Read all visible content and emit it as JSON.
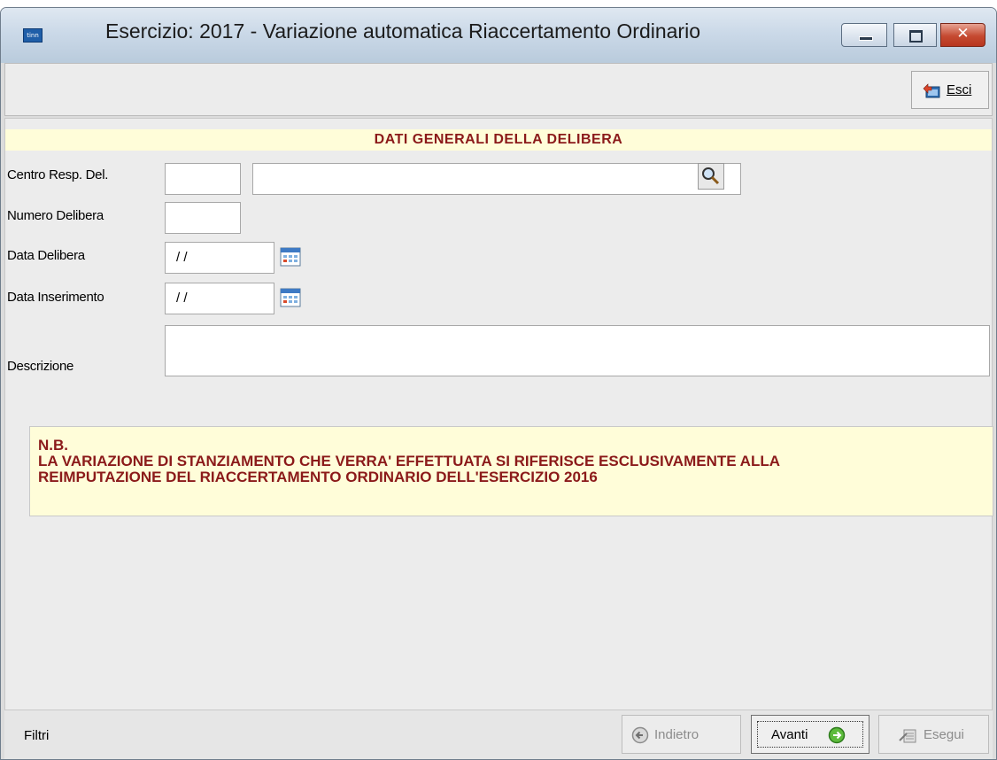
{
  "window": {
    "title": "Esercizio: 2017 - Variazione automatica Riaccertamento Ordinario",
    "app_icon_text": "tinn"
  },
  "toolbar": {
    "esci_label": "Esci"
  },
  "form": {
    "header": "DATI GENERALI DELLA DELIBERA",
    "centro_label": "Centro Resp. Del.",
    "centro_code_value": "",
    "centro_desc_value": "",
    "numero_label": "Numero Delibera",
    "numero_value": "",
    "data_delibera_label": "Data Delibera",
    "data_delibera_value": "/ /",
    "data_inserimento_label": "Data Inserimento",
    "data_inserimento_value": "/ /",
    "descrizione_label": "Descrizione",
    "descrizione_value": ""
  },
  "note": {
    "line1": "N.B.",
    "line2": "LA VARIAZIONE DI STANZIAMENTO CHE VERRA' EFFETTUATA SI RIFERISCE ESCLUSIVAMENTE ALLA",
    "line3": "REIMPUTAZIONE DEL RIACCERTAMENTO ORDINARIO DELL'ESERCIZIO 2016"
  },
  "statusbar": {
    "filtri_label": "Filtri",
    "indietro_label": "Indietro",
    "avanti_label": "Avanti",
    "esegui_label": "Esegui"
  },
  "colors": {
    "header_text": "#8b1a1a",
    "header_bg": "#fffdd9",
    "window_bg": "#ececec",
    "close_button": "#c54a31"
  },
  "icons": {
    "app": "app-icon",
    "minimize": "minimize-icon",
    "maximize": "maximize-icon",
    "close": "close-icon",
    "esci": "exit-icon",
    "search": "search-icon",
    "calendar": "calendar-icon",
    "indietro": "arrow-left-icon",
    "avanti": "arrow-right-icon",
    "esegui": "execute-icon"
  }
}
